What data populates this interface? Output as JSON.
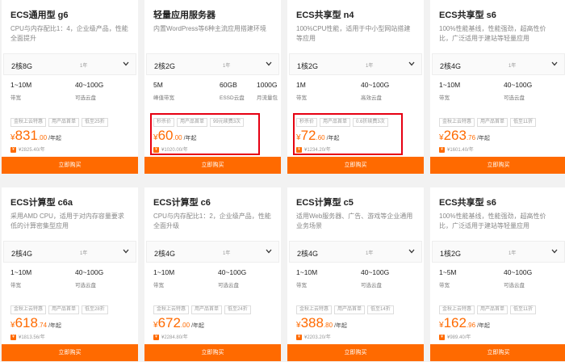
{
  "colors": {
    "accent": "#ff6a00",
    "highlight": "#e60012",
    "bg": "#f2f2f2"
  },
  "cards": [
    {
      "title": "ECS通用型 g6",
      "desc": "CPU与内存配比1：4，企业级产品，性能全面提升",
      "spec": "2核8G",
      "year": "1年",
      "params": [
        {
          "v": "1~10M",
          "l": "带宽"
        },
        {
          "v": "40~100G",
          "l": "可选云盘"
        }
      ],
      "tags": [
        "金秋上云特惠",
        "用产品首单",
        "低至25折"
      ],
      "price": {
        "cur": "¥",
        "int": "831",
        "dec": ".00",
        "unit": "/年起"
      },
      "orig": "¥2825.40/年",
      "buy": "立即购买",
      "highlighted": false
    },
    {
      "title": "轻量应用服务器",
      "desc": "内置WordPress等6种主流应用搭建环境",
      "spec": "2核2G",
      "year": "1年",
      "params": [
        {
          "v": "5M",
          "l": "峰值带宽"
        },
        {
          "v": "60GB",
          "l": "ESSD云盘"
        },
        {
          "v": "1000G",
          "l": "月流量包"
        }
      ],
      "tags": [
        "秒杀价",
        "用产品首单",
        "99元续费3次"
      ],
      "price": {
        "cur": "¥",
        "int": "60",
        "dec": ".00",
        "unit": "/年起"
      },
      "orig": "¥1020.00/年",
      "buy": "立即购买",
      "highlighted": true
    },
    {
      "title": "ECS共享型 n4",
      "desc": "100%CPU性能，适用于中小型网站搭建等应用",
      "spec": "1核2G",
      "year": "1年",
      "params": [
        {
          "v": "1M",
          "l": "带宽"
        },
        {
          "v": "40~100G",
          "l": "高效云盘"
        }
      ],
      "tags": [
        "秒杀价",
        "用产品首单",
        "0.6折续费3次"
      ],
      "price": {
        "cur": "¥",
        "int": "72",
        "dec": ".60",
        "unit": "/年起"
      },
      "orig": "¥1234.20/年",
      "buy": "立即购买",
      "highlighted": true
    },
    {
      "title": "ECS共享型 s6",
      "desc": "100%性能基线，性能强劲，超高性价比，广泛适用于建站等轻量应用",
      "spec": "2核4G",
      "year": "1年",
      "params": [
        {
          "v": "1~10M",
          "l": "带宽"
        },
        {
          "v": "40~100G",
          "l": "可选云盘"
        }
      ],
      "tags": [
        "金秋上云特惠",
        "用产品首单",
        "低至11折"
      ],
      "price": {
        "cur": "¥",
        "int": "263",
        "dec": ".76",
        "unit": "/年起"
      },
      "orig": "¥1601.40/年",
      "buy": "立即购买",
      "highlighted": false
    },
    {
      "title": "ECS计算型 c6a",
      "desc": "采用AMD CPU，适用于对内存容量要求低的计算密集型应用",
      "spec": "2核4G",
      "year": "1年",
      "params": [
        {
          "v": "1~10M",
          "l": "带宽"
        },
        {
          "v": "40~100G",
          "l": "可选云盘"
        }
      ],
      "tags": [
        "金秋上云特惠",
        "用产品首单",
        "低至28折"
      ],
      "price": {
        "cur": "¥",
        "int": "618",
        "dec": ".74",
        "unit": "/年起"
      },
      "orig": "¥1813.56/年",
      "buy": "立即购买",
      "highlighted": false
    },
    {
      "title": "ECS计算型 c6",
      "desc": "CPU与内存配比1：2，企业级产品，性能全面升级",
      "spec": "2核4G",
      "year": "1年",
      "params": [
        {
          "v": "1~10M",
          "l": "带宽"
        },
        {
          "v": "40~100G",
          "l": "可选云盘"
        }
      ],
      "tags": [
        "金秋上云特惠",
        "用产品首单",
        "低至24折"
      ],
      "price": {
        "cur": "¥",
        "int": "672",
        "dec": ".00",
        "unit": "/年起"
      },
      "orig": "¥2284.80/年",
      "buy": "立即购买",
      "highlighted": false
    },
    {
      "title": "ECS计算型 c5",
      "desc": "适用Web服务器、广告、游戏等企业通用业务场景",
      "spec": "2核4G",
      "year": "1年",
      "params": [
        {
          "v": "1~10M",
          "l": "带宽"
        },
        {
          "v": "40~100G",
          "l": "可选云盘"
        }
      ],
      "tags": [
        "金秋上云特惠",
        "用产品首单",
        "低至14折"
      ],
      "price": {
        "cur": "¥",
        "int": "388",
        "dec": ".80",
        "unit": "/年起"
      },
      "orig": "¥2203.20/年",
      "buy": "立即购买",
      "highlighted": false
    },
    {
      "title": "ECS共享型 s6",
      "desc": "100%性能基线，性能强劲，超高性价比，广泛适用于建站等轻量应用",
      "spec": "1核2G",
      "year": "1年",
      "params": [
        {
          "v": "1~5M",
          "l": "带宽"
        },
        {
          "v": "40~100G",
          "l": "可选云盘"
        }
      ],
      "tags": [
        "金秋上云特惠",
        "用产品首单",
        "低至11折"
      ],
      "price": {
        "cur": "¥",
        "int": "162",
        "dec": ".96",
        "unit": "/年起"
      },
      "orig": "¥989.40/年",
      "buy": "立即购买",
      "highlighted": false
    }
  ]
}
